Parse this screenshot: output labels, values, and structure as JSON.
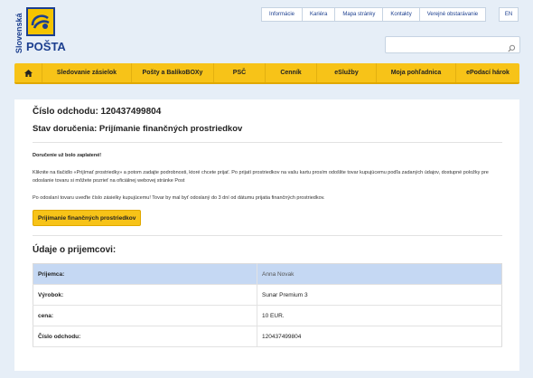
{
  "brand": {
    "side_text": "Slovenská",
    "name": "POŠTA"
  },
  "top_links": [
    "Informácie",
    "Kariéra",
    "Mapa stránky",
    "Kontakty",
    "Verejné obstarávanie"
  ],
  "language": "EN",
  "search": {
    "placeholder": ""
  },
  "nav": [
    "Sledovanie zásielok",
    "Pošty a BalíkoBOXy",
    "PSČ",
    "Cenník",
    "eSlužby",
    "Moja pohľadnica",
    "ePodací hárok"
  ],
  "shipment": {
    "number_heading": "Číslo odchodu: 120437499804",
    "status_heading": "Stav doručenia: Prijímanie finančných prostriedkov",
    "notice": "Doručenie už bolo zaplatené!",
    "paragraph1": "Kliknite na tlačidlo «Prijímať prostriedky» a potom zadajte podrobnosti, ktoré chcete prijať. Po prijatí prostriedkov na vašu kartu prosím odošlite tovar kupujúcemu podľa zadaných údajov, dostupné položky pre odoslanie tovaru si môžete pozrieť na oficiálnej webovej stránke Post",
    "paragraph2": "Po odoslaní tovaru uveďte číslo zásielky kupujúcemu! Tovar by mal byť odoslaný do 3 dní od dátumu prijatia finančných prostriedkov.",
    "button": "Prijímanie finančných prostriedkov"
  },
  "recipient": {
    "heading": "Údaje o prijemcovi:",
    "rows": [
      {
        "label": "Prijemca:",
        "value": "Anna Novak"
      },
      {
        "label": "Výrobok:",
        "value": "Sunar Premium 3"
      },
      {
        "label": "cena:",
        "value": "10 EUR."
      },
      {
        "label": "Číslo odchodu:",
        "value": "120437499804"
      }
    ]
  },
  "colors": {
    "accent": "#f7c318",
    "brand_blue": "#1c3f8f",
    "table_header": "#c5d8f3",
    "page_bg": "#e6eef7"
  },
  "icons": {
    "home": "home-icon",
    "search": "search-icon",
    "logo": "posthorn-icon"
  }
}
